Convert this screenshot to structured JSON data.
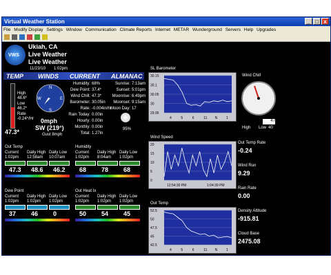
{
  "window": {
    "title": "Virtual Weather Station"
  },
  "menu": [
    "File",
    "Modify Display",
    "Settings",
    "Window",
    "Communication",
    "Climate Reports",
    "Internet",
    "METAR",
    "Wunderground",
    "Servers",
    "Help",
    "Upgrades"
  ],
  "location": {
    "city": "Ukiah, CA",
    "line2": "Live Weather",
    "line3": "Live Weather",
    "date": "11/23/10",
    "time": "1:02pm"
  },
  "sections": {
    "temp": "TEMP",
    "winds": "WINDS",
    "current": "CURRENT",
    "almanac": "ALMANAC"
  },
  "temp": {
    "high_label": "High",
    "high": "48.6*",
    "low_label": "Low",
    "low": "46.2*",
    "rate_label": "Rate",
    "rate": "-0.24*/Hr",
    "current": "47.3*",
    "level": 0.47
  },
  "winds": {
    "speed": "0mph",
    "dir": "SW (219°)",
    "gust": "Gust  8mph",
    "compass": [
      "N",
      "E",
      "S",
      "W"
    ]
  },
  "current": [
    {
      "k": "Humidity:",
      "v": "68%"
    },
    {
      "k": "Dew Point:",
      "v": "37.4*"
    },
    {
      "k": "Wind Chill:",
      "v": "47.3*"
    },
    {
      "k": "Barometer:",
      "v": "30.05in"
    },
    {
      "k": "Rate:",
      "v": "-0.004in/hr"
    },
    {
      "k": "Rain Today:",
      "v": "0.00in"
    },
    {
      "k": "Hourly:",
      "v": "0.00in"
    },
    {
      "k": "Monthly:",
      "v": "0.00in"
    },
    {
      "k": "Total:",
      "v": "1.27in"
    }
  ],
  "almanac": [
    {
      "k": "Sunrise:",
      "v": "7:13am"
    },
    {
      "k": "Sunset:",
      "v": "5:01pm"
    },
    {
      "k": "Moonrise:",
      "v": "6:49pm"
    },
    {
      "k": "Moonset:",
      "v": "9:15am"
    },
    {
      "k": "Moon Day:",
      "v": "17"
    }
  ],
  "moon_pct": "95%",
  "bars": {
    "out_temp": {
      "title": "Out Temp",
      "cur_l": "Current",
      "cur_t": "1:02pm",
      "hi_l": "Daily High",
      "hi_t": "12:58am",
      "lo_l": "Daily Low",
      "lo_t": "10:07am",
      "cur": "47.3",
      "hi": "48.6",
      "lo": "46.2"
    },
    "humidity": {
      "title": "Humidity",
      "cur_l": "Current",
      "cur_t": "1:02pm",
      "hi_l": "Daily High",
      "hi_t": "8:04am",
      "lo_l": "Daily Low",
      "lo_t": "1:02pm",
      "cur": "68",
      "hi": "78",
      "lo": "68"
    },
    "dew_point": {
      "title": "Dew Point",
      "cur_l": "Current",
      "cur_t": "1:02pm",
      "hi_l": "Daily High",
      "hi_t": "1:02pm",
      "lo_l": "Daily Low",
      "lo_t": "1:02pm",
      "cur": "37",
      "hi": "46",
      "lo": "0"
    },
    "out_heat": {
      "title": "Out Heat Ix",
      "cur_l": "Current",
      "cur_t": "1:02pm",
      "hi_l": "Daily High",
      "hi_t": "1:02pm",
      "lo_l": "Daily Low",
      "lo_t": "1:02pm",
      "cur": "50",
      "hi": "54",
      "lo": "45"
    }
  },
  "graphs": {
    "baro": {
      "title": "SL Barometer",
      "y": [
        "30.15",
        "30.1",
        "30.05",
        "30",
        "29.95"
      ],
      "x": [
        "4",
        "5",
        "6",
        "11",
        "N",
        "1"
      ]
    },
    "wind": {
      "title": "Wind Speed",
      "y": [
        "20",
        "15",
        "10",
        "5",
        "0"
      ],
      "x": [
        "12:54:30 PM",
        "1:04:39 PM"
      ]
    },
    "otemp": {
      "title": "Out Temp",
      "y": [
        "52.5",
        "50",
        "47.5",
        "45",
        "42.5"
      ],
      "x": [
        "4",
        "5",
        "6",
        "11",
        "N",
        "1"
      ]
    }
  },
  "chill": {
    "title": "Wind Chill",
    "high": "High",
    "low": "Low",
    "low_v": "40",
    "value": "47"
  },
  "readouts": [
    {
      "k": "Out Temp Rate",
      "v": "-0.24"
    },
    {
      "k": "Wind Run",
      "v": "9.29"
    },
    {
      "k": "Rain Rate",
      "v": "0.00"
    },
    {
      "k": "Density Altitude",
      "v": "-915.81"
    },
    {
      "k": "Cloud Base",
      "v": "2475.08"
    }
  ],
  "logo": "VWS",
  "colors": {
    "bg": "#000000",
    "graph_plot": "#1f2f9f",
    "accent": "#3050c0"
  }
}
